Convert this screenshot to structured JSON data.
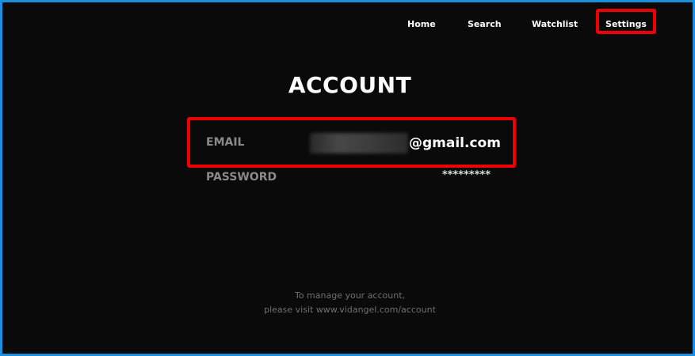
{
  "nav": {
    "items": [
      {
        "label": "Home"
      },
      {
        "label": "Search"
      },
      {
        "label": "Watchlist"
      },
      {
        "label": "Settings",
        "selected": true
      }
    ]
  },
  "page": {
    "title": "ACCOUNT"
  },
  "account": {
    "email_label": "EMAIL",
    "email_domain": "@gmail.com",
    "password_label": "PASSWORD",
    "password_value": "*********"
  },
  "footer": {
    "line1": "To manage your account,",
    "line2": "please visit www.vidangel.com/account"
  },
  "colors": {
    "background": "#0a0a0a",
    "frame_border": "#1a8fe0",
    "highlight": "#ee0000",
    "text_primary": "#ffffff",
    "text_muted": "#8a8a8a"
  }
}
